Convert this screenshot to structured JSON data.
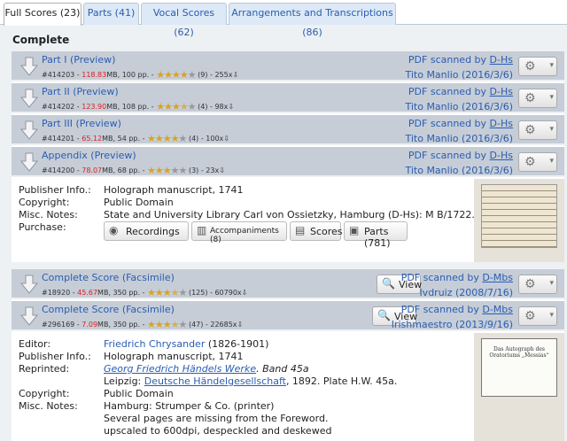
{
  "tabs": [
    {
      "label": "Full Scores (23)",
      "active": true
    },
    {
      "label": "Parts (41)",
      "active": false
    },
    {
      "label": "Vocal Scores (62)",
      "active": false
    },
    {
      "label": "Arrangements and Transcriptions (86)",
      "active": false
    }
  ],
  "section_title": "Complete",
  "group1": {
    "files": [
      {
        "title": "Part I",
        "preview": "(Preview)",
        "id": "#414203",
        "size": "118.83",
        "size_unit": "MB",
        "pages": "100 pp.",
        "rating": 4,
        "votes": "(9)",
        "downloads": "255x",
        "scanned": "PDF scanned by",
        "scanner": "D-Hs",
        "uploader": "Tito Manlio",
        "date": "(2016/3/6)"
      },
      {
        "title": "Part II",
        "preview": "(Preview)",
        "id": "#414202",
        "size": "123.90",
        "size_unit": "MB",
        "pages": "108 pp.",
        "rating": 3.5,
        "votes": "(4)",
        "downloads": "98x",
        "scanned": "PDF scanned by",
        "scanner": "D-Hs",
        "uploader": "Tito Manlio",
        "date": "(2016/3/6)"
      },
      {
        "title": "Part III",
        "preview": "(Preview)",
        "id": "#414201",
        "size": "65.12",
        "size_unit": "MB",
        "pages": "54 pp.",
        "rating": 4,
        "votes": "(4)",
        "downloads": "100x",
        "scanned": "PDF scanned by",
        "scanner": "D-Hs",
        "uploader": "Tito Manlio",
        "date": "(2016/3/6)"
      },
      {
        "title": "Appendix",
        "preview": "(Preview)",
        "id": "#414200",
        "size": "78.07",
        "size_unit": "MB",
        "pages": "68 pp.",
        "rating": 3,
        "votes": "(3)",
        "downloads": "23x",
        "scanned": "PDF scanned by",
        "scanner": "D-Hs",
        "uploader": "Tito Manlio",
        "date": "(2016/3/6)"
      }
    ],
    "info": [
      {
        "label": "Publisher Info.:",
        "value": "Holograph manuscript, 1741",
        "link": false
      },
      {
        "label": "Copyright:",
        "value": "Public Domain",
        "link": true
      },
      {
        "label": "Misc. Notes:",
        "value": "State and University Library Carl von Ossietzky, Hamburg (D-Hs): M B/1722.",
        "link": false
      },
      {
        "label": "Purchase:",
        "value": "",
        "link": false
      }
    ],
    "purchase": {
      "recordings": "Recordings",
      "accompaniments": "Accompaniments (8)",
      "scores": "Scores",
      "parts": "Parts (781)"
    }
  },
  "group2": {
    "files": [
      {
        "title": "Complete Score (Facsimile)",
        "id": "#18920",
        "size": "45.67",
        "size_unit": "MB",
        "pages": "350 pp.",
        "rating": 3.5,
        "votes": "(125)",
        "downloads": "60790x",
        "view": "View",
        "scanned": "PDF scanned by",
        "scanner": "D-Mbs",
        "uploader": "Ivdruiz",
        "date": "(2008/7/16)"
      },
      {
        "title": "Complete Score (Facsimile)",
        "id": "#296169",
        "size": "7.09",
        "size_unit": "MB",
        "pages": "350 pp.",
        "rating": 3.5,
        "votes": "(47)",
        "downloads": "22685x",
        "view": "View",
        "scanned": "PDF scanned by",
        "scanner": "D-Mbs",
        "uploader": "Irishmaestro",
        "date": "(2013/9/16)"
      }
    ],
    "editor_label": "Editor:",
    "editor": "Friedrich Chrysander",
    "editor_years": "(1826-1901)",
    "pub_label": "Publisher Info.:",
    "pub": "Holograph manuscript, 1741",
    "reprint_label": "Reprinted:",
    "reprint_title": "Georg Friedrich Händels Werke",
    "reprint_band": ". Band 45a",
    "reprint2_a": "Leipzig: ",
    "reprint2_link": "Deutsche Händelgesellschaft",
    "reprint2_b": ", 1892. Plate H.W. 45a.",
    "copyright_label": "Copyright:",
    "copyright": "Public Domain",
    "misc_label": "Misc. Notes:",
    "misc1": "Hamburg: Strumper & Co. (printer)",
    "misc2": "Several pages are missing from the Foreword.",
    "misc3": "upscaled to 600dpi, despeckled and deskewed",
    "thumb_title": "Das Autograph des Oratoriums „Messias“"
  }
}
